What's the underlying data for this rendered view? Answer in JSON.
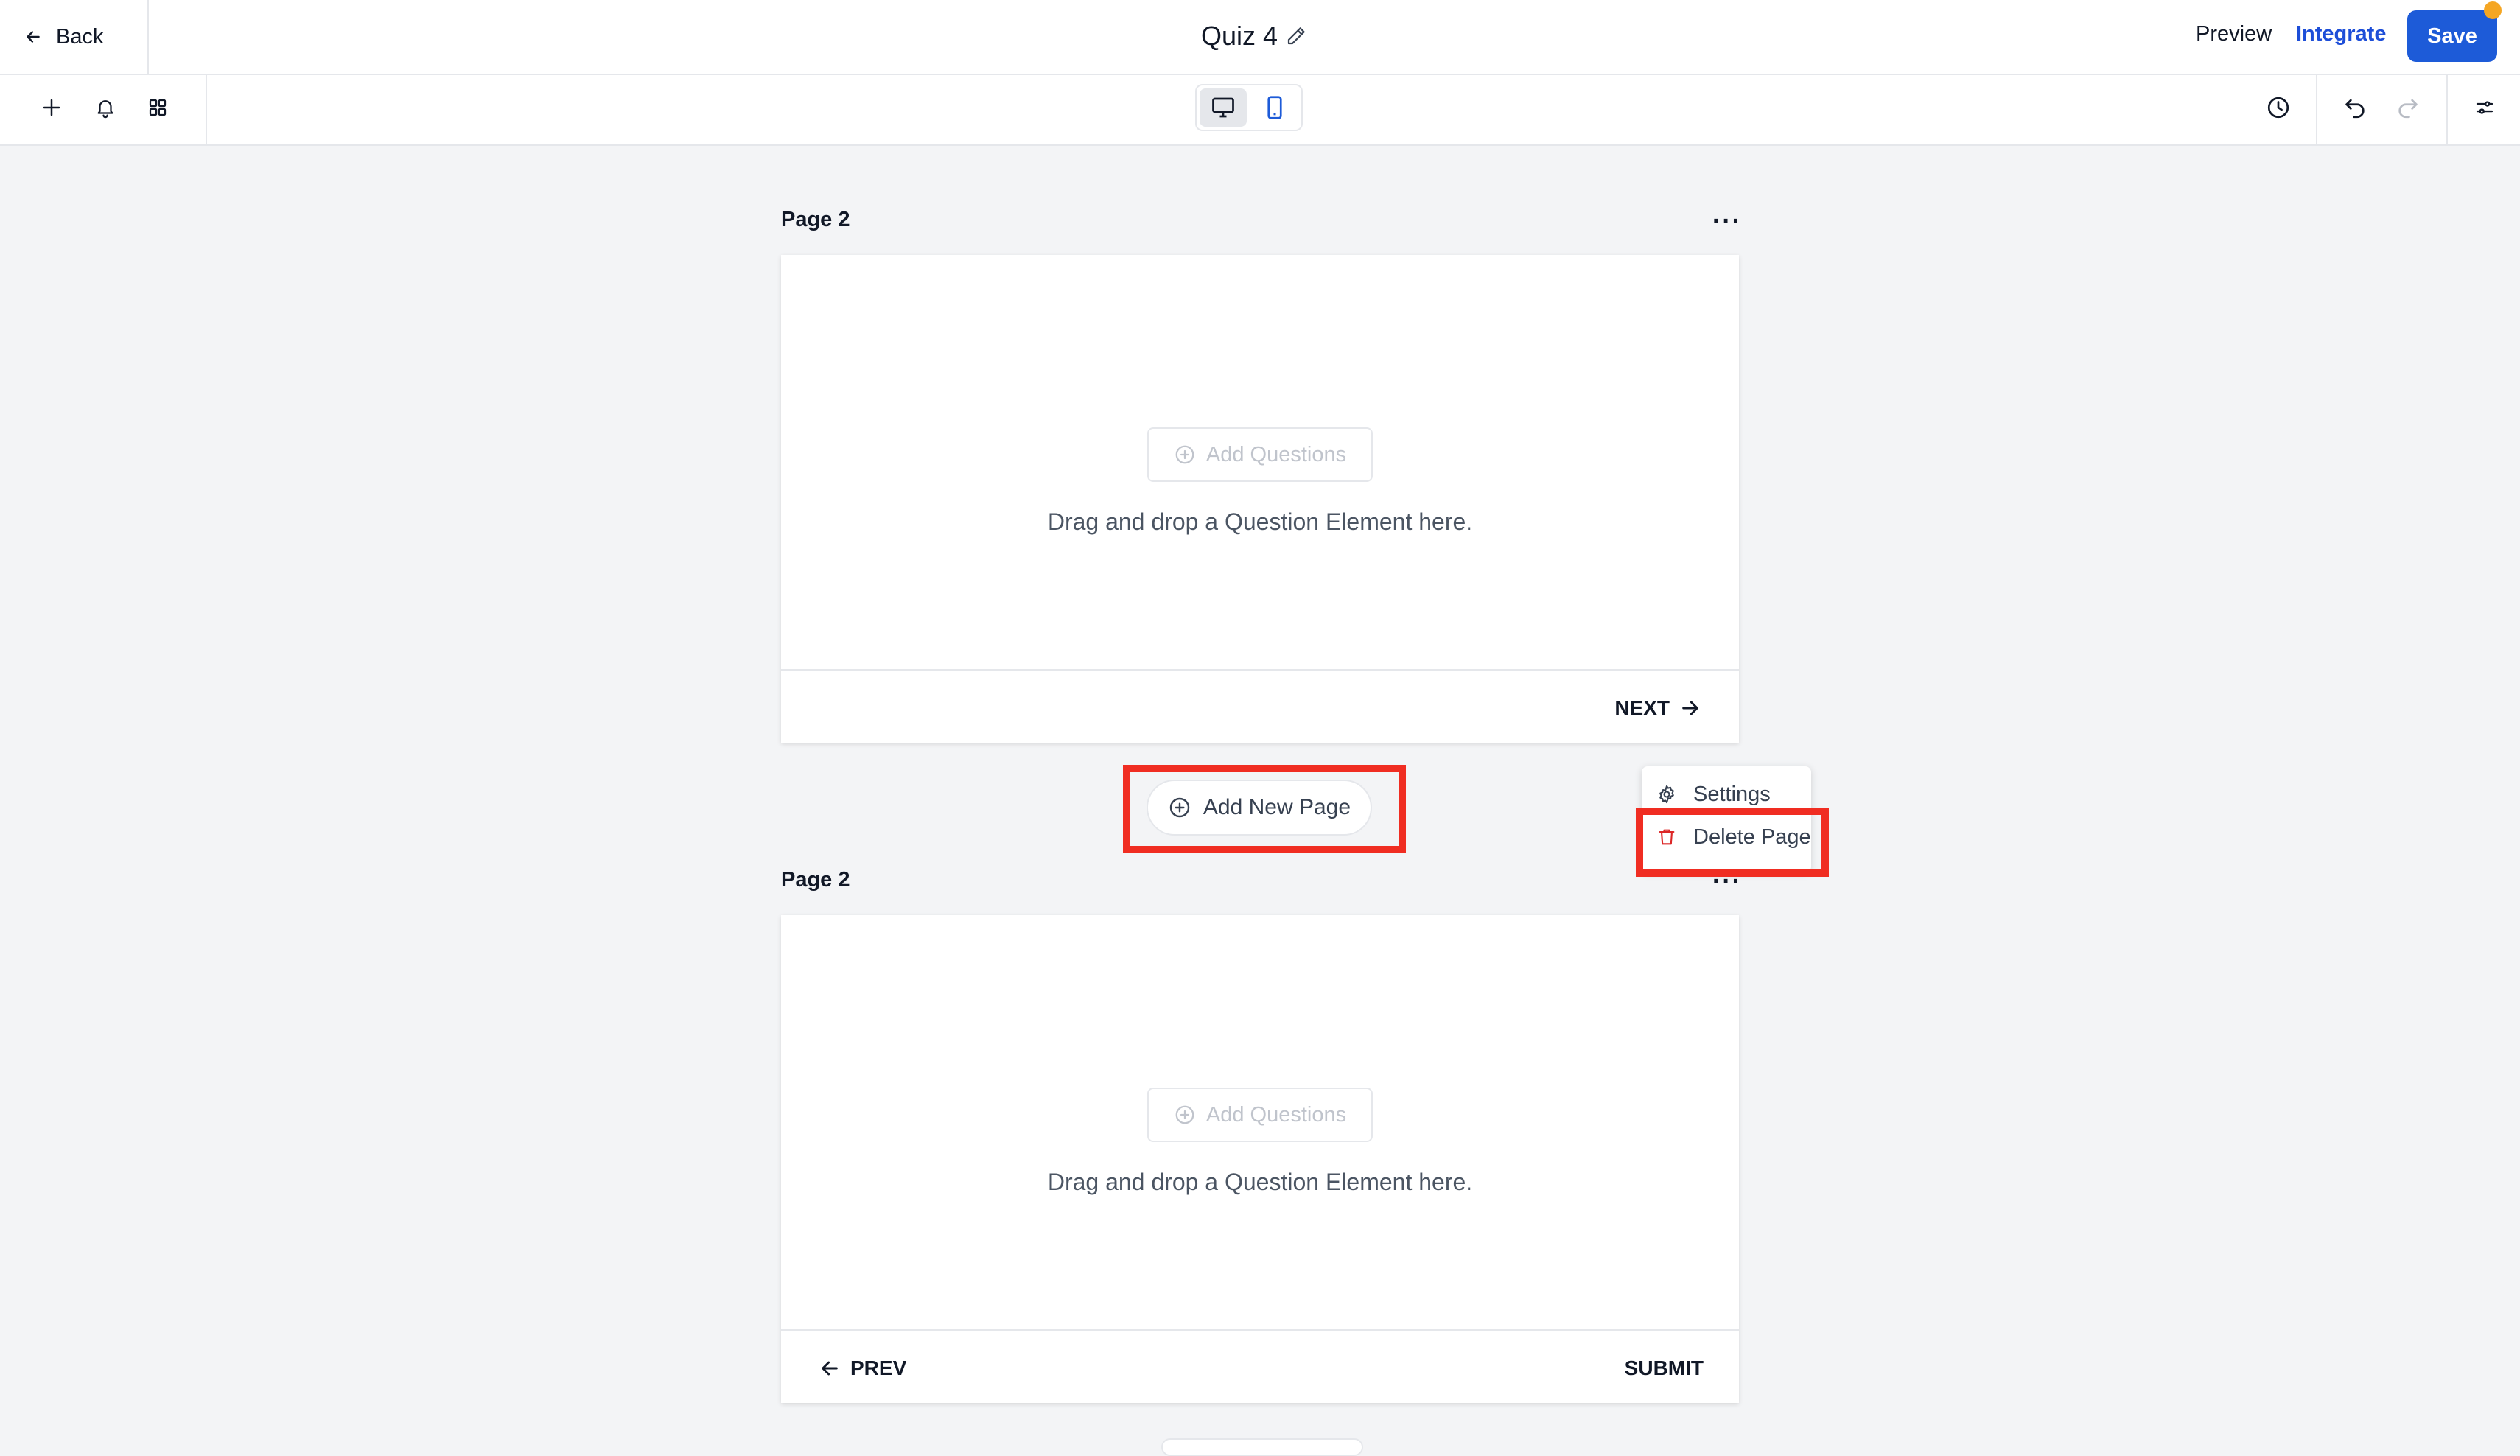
{
  "topbar": {
    "back_label": "Back",
    "title": "Quiz 4",
    "preview_label": "Preview",
    "integrate_label": "Integrate",
    "save_label": "Save"
  },
  "toolbar": {
    "icons": [
      "plus-icon",
      "bell-icon",
      "grid-icon",
      "desktop-icon",
      "mobile-icon",
      "history-icon",
      "undo-icon",
      "redo-icon",
      "settings-sliders-icon"
    ]
  },
  "pages": [
    {
      "label": "Page 2",
      "add_questions_label": "Add Questions",
      "drop_hint": "Drag and drop a Question Element here.",
      "next_label": "NEXT"
    },
    {
      "label": "Page 2",
      "add_questions_label": "Add Questions",
      "drop_hint": "Drag and drop a Question Element here.",
      "prev_label": "PREV",
      "submit_label": "SUBMIT"
    }
  ],
  "add_new_page_label": "Add New Page",
  "context_menu": {
    "items": [
      {
        "label": "Settings",
        "icon": "gear-icon"
      },
      {
        "label": "Delete Page",
        "icon": "trash-icon"
      }
    ]
  },
  "colors": {
    "primary": "#1d5bd8",
    "highlight": "#f02d22",
    "danger": "#dc2626",
    "canvas": "#f3f4f6"
  }
}
